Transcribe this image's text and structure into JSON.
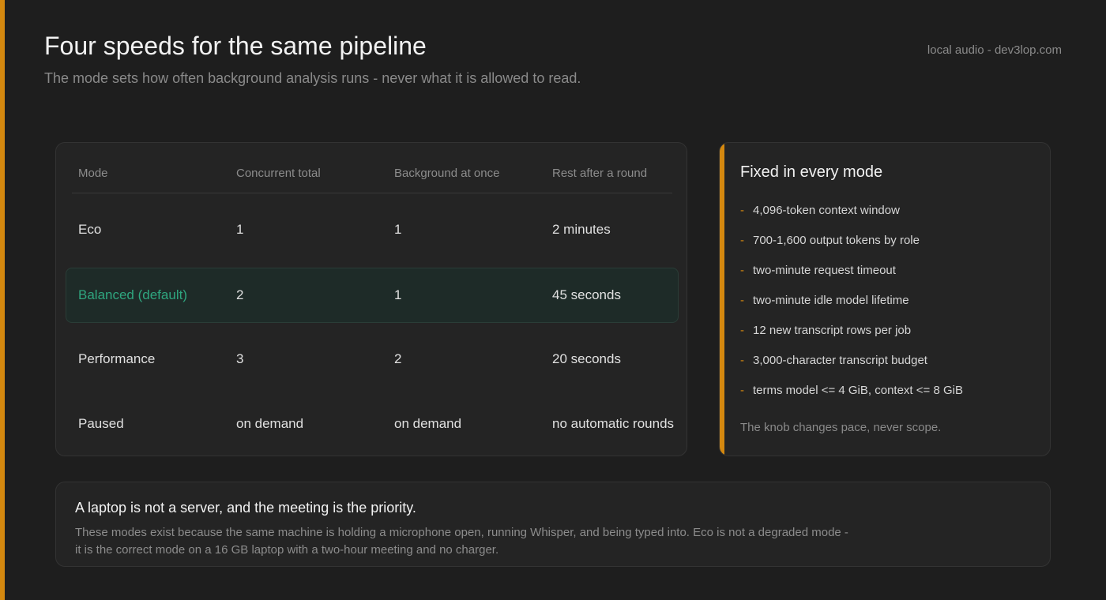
{
  "header": {
    "title": "Four speeds for the same pipeline",
    "subtitle": "The mode sets how often background analysis runs - never what it is allowed to read.",
    "source": "local audio - dev3lop.com"
  },
  "table": {
    "columns": [
      "Mode",
      "Concurrent total",
      "Background at once",
      "Rest after a round"
    ],
    "rows": [
      {
        "mode": "Eco",
        "concurrent": "1",
        "background": "1",
        "rest": "2 minutes"
      },
      {
        "mode": "Balanced (default)",
        "concurrent": "2",
        "background": "1",
        "rest": "45 seconds"
      },
      {
        "mode": "Performance",
        "concurrent": "3",
        "background": "2",
        "rest": "20 seconds"
      },
      {
        "mode": "Paused",
        "concurrent": "on demand",
        "background": "on demand",
        "rest": "no automatic rounds"
      }
    ]
  },
  "fixed": {
    "title": "Fixed in every mode",
    "items": [
      "4,096-token context window",
      "700-1,600 output tokens by role",
      "two-minute request timeout",
      "two-minute idle model lifetime",
      "12 new transcript rows per job",
      "3,000-character transcript budget",
      "terms model <= 4 GiB, context <= 8 GiB"
    ],
    "bullet": "-",
    "note": "The knob changes pace, never scope."
  },
  "note": {
    "title": "A laptop is not a server, and the meeting is the priority.",
    "body": "These modes exist because the same machine is holding a microphone open, running Whisper, and being typed into. Eco is not a degraded mode - it is the correct mode on a 16 GB laptop with a two-hour meeting and no charger."
  },
  "colors": {
    "accent": "#d4880f",
    "highlight_text": "#2fa67f",
    "background": "#1e1e1e"
  }
}
